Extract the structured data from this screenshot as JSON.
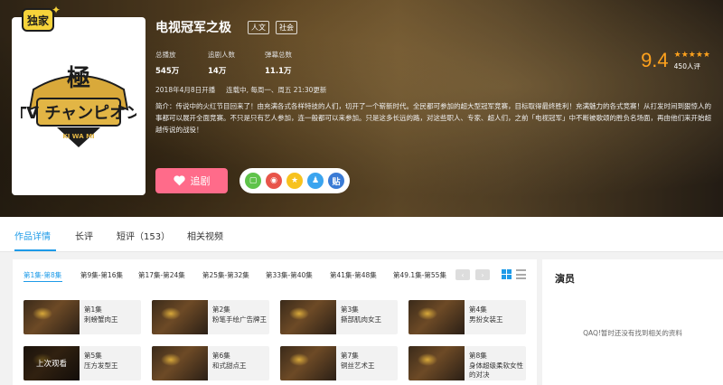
{
  "hero": {
    "badge": "独家",
    "title": "电视冠军之极",
    "tags": [
      "人文",
      "社会"
    ],
    "stats": [
      {
        "label": "总播放",
        "value": "545万"
      },
      {
        "label": "追剧人数",
        "value": "14万"
      },
      {
        "label": "弹幕总数",
        "value": "11.1万"
      }
    ],
    "start_date": "2018年4月8日开播",
    "update_info": "连载中, 每周一、周五 21:30更新",
    "description": "简介：传说中的火红节目回来了！由充满各式各样特技的人们，切开了一个崭新时代。全民都可参加的超大型冠军竞赛，目标取得最终胜利！充满魅力的各式竞赛！从打发时间到狠惊人的事都可以展开全面竞赛。不只是只有艺人参加，连一般都可以来参加。只是这多长远的路，对这些职人、专家、超人们，之前「电视冠军」中不断被歌颂的胜负名场面，再由他们来开始超越传说的战役！",
    "score": "9.4",
    "stars": "★★★★★",
    "raters": "450人评",
    "follow_label": "追剧",
    "logo_text": "KI WA MI",
    "share_icons": [
      {
        "name": "wechat-icon",
        "color": "#5fc34a",
        "glyph": "▢"
      },
      {
        "name": "weibo-icon",
        "color": "#e8544a",
        "glyph": "◉"
      },
      {
        "name": "qzone-icon",
        "color": "#f7c21e",
        "glyph": "★"
      },
      {
        "name": "qq-icon",
        "color": "#3aa4ef",
        "glyph": "♟"
      },
      {
        "name": "tieba-icon",
        "color": "#3a7bd5",
        "glyph": "贴"
      }
    ]
  },
  "tabs": [
    {
      "label": "作品详情"
    },
    {
      "label": "长评"
    },
    {
      "label": "短评（153）"
    },
    {
      "label": "相关视频"
    }
  ],
  "episode_ranges": [
    "第1集-第8集",
    "第9集-第16集",
    "第17集-第24集",
    "第25集-第32集",
    "第33集-第40集",
    "第41集-第48集",
    "第49.1集-第55集"
  ],
  "pager": {
    "prev": "‹",
    "next": "›"
  },
  "episodes": [
    {
      "num": "第1集",
      "name": "刺螃蟹肉王"
    },
    {
      "num": "第2集",
      "name": "粉笔手绘广告牌王"
    },
    {
      "num": "第3集",
      "name": "撕部肌肉女王"
    },
    {
      "num": "第4集",
      "name": "男扮女装王"
    },
    {
      "num": "第5集",
      "name": "压方发型王",
      "overlay": "上次观看"
    },
    {
      "num": "第6集",
      "name": "和式甜点王"
    },
    {
      "num": "第7集",
      "name": "铜丝艺术王"
    },
    {
      "num": "第8集",
      "name": "身体超级柔软女性的对决"
    }
  ],
  "cast": {
    "title": "演员",
    "empty": "QAQ!暂时还没有找到相关的资料"
  }
}
